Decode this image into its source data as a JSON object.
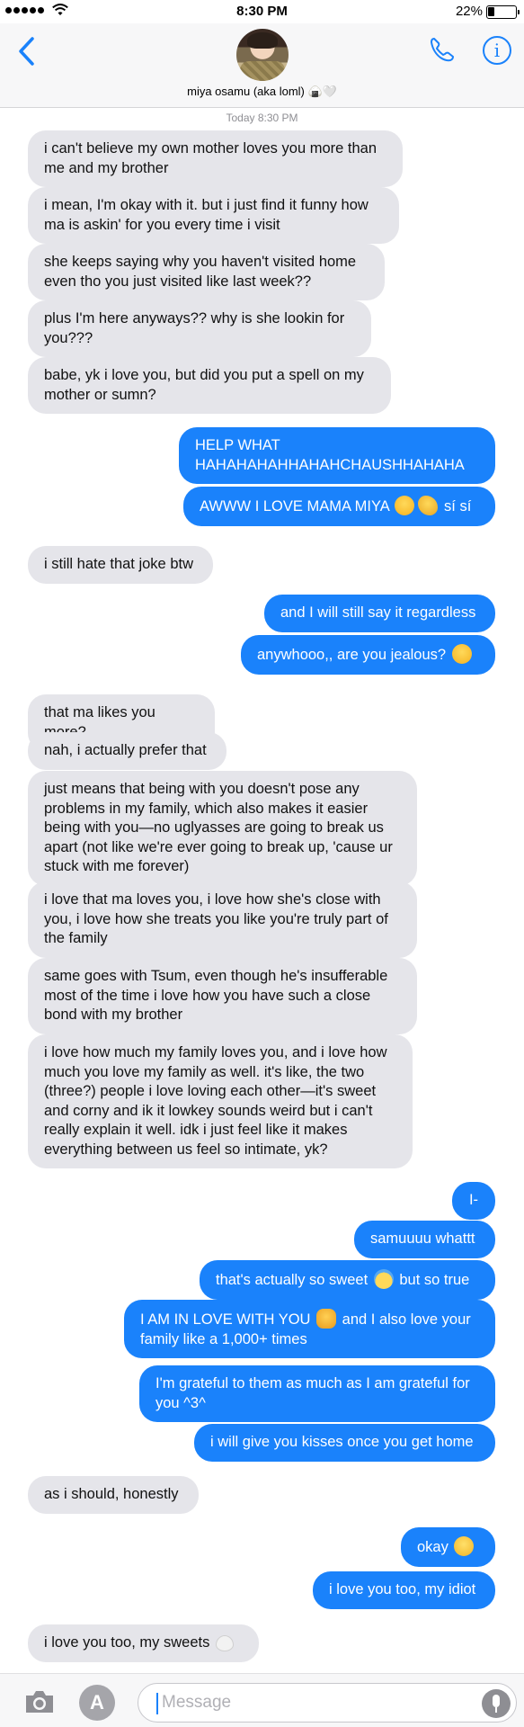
{
  "status": {
    "time": "8:30 PM",
    "battery": "22%"
  },
  "header": {
    "contact_name": "miya osamu (aka loml) 🍙🤍"
  },
  "timestamp": "Today 8:30 PM",
  "messages": [
    {
      "from": "them",
      "text": "i can't believe my own mother loves you more than me and my brother"
    },
    {
      "from": "them",
      "text": "i mean, I'm okay with it. but i just find it funny how ma is askin' for you every time i visit"
    },
    {
      "from": "them",
      "text": "she keeps saying why you haven't visited home even tho you just visited like last week??"
    },
    {
      "from": "them",
      "text": "plus I'm here anyways?? why is she lookin for you???"
    },
    {
      "from": "them",
      "text": "babe, yk i love you, but did you put a spell on my mother or sumn?"
    },
    {
      "from": "me",
      "text": "HELP WHAT HAHAHAHAHHAHAHCHAUSHHAHAHA"
    },
    {
      "from": "me",
      "text": "AWWW I LOVE MAMA MIYA",
      "tail": "sí sí"
    },
    {
      "from": "them",
      "text": "i still hate that joke btw"
    },
    {
      "from": "me",
      "text": "and I will still say it regardless"
    },
    {
      "from": "me",
      "text": "anywhooo,, are you jealous?"
    },
    {
      "from": "them",
      "text": "that ma likes you more?"
    },
    {
      "from": "them",
      "text": "nah, i actually prefer that"
    },
    {
      "from": "them",
      "text": "just means that being with you doesn't pose any problems in my family, which also makes it easier being with you—no uglyasses are going to break us apart (not like we're ever going to break up, 'cause ur stuck with me forever)"
    },
    {
      "from": "them",
      "text": "i love that ma loves you, i love how she's close with you, i love how she treats you like you're truly part of the family"
    },
    {
      "from": "them",
      "text": "same goes with Tsum, even though he's insufferable most of the time i love how you have such a close bond with my brother"
    },
    {
      "from": "them",
      "text": "i love how much my family loves you, and i love how much you love my family as well. it's like, the two (three?) people i love loving each other—it's sweet and corny and ik it lowkey sounds weird but i can't really explain it well. idk i just feel like it makes everything between us feel so intimate, yk?"
    },
    {
      "from": "me",
      "text": "I-"
    },
    {
      "from": "me",
      "text": "samuuuu whattt"
    },
    {
      "from": "me",
      "text": "that's actually so sweet",
      "tail": "but so true"
    },
    {
      "from": "me",
      "text": "I AM IN LOVE WITH YOU",
      "tail": "and I also love your family like a 1,000+ times"
    },
    {
      "from": "me",
      "text": "I'm grateful to them as much as I am grateful for you ^3^"
    },
    {
      "from": "me",
      "text": "i will give you kisses once you get home"
    },
    {
      "from": "them",
      "text": "as i should, honestly"
    },
    {
      "from": "me",
      "text": "okay"
    },
    {
      "from": "me",
      "text": "i love you too, my idiot"
    },
    {
      "from": "them",
      "text": "i love you too, my sweets"
    }
  ],
  "icons": {
    "back": "chevron-left-icon",
    "phone": "phone-icon",
    "info": "info-icon",
    "camera": "camera-icon",
    "apps": "app-store-icon",
    "mic": "microphone-icon"
  },
  "toolbar": {
    "info_glyph": "i",
    "apps_glyph": "A",
    "placeholder": "Message"
  },
  "colors": {
    "sent": "#1a82fb",
    "received": "#e5e5ea",
    "accent": "#1a82fb"
  }
}
